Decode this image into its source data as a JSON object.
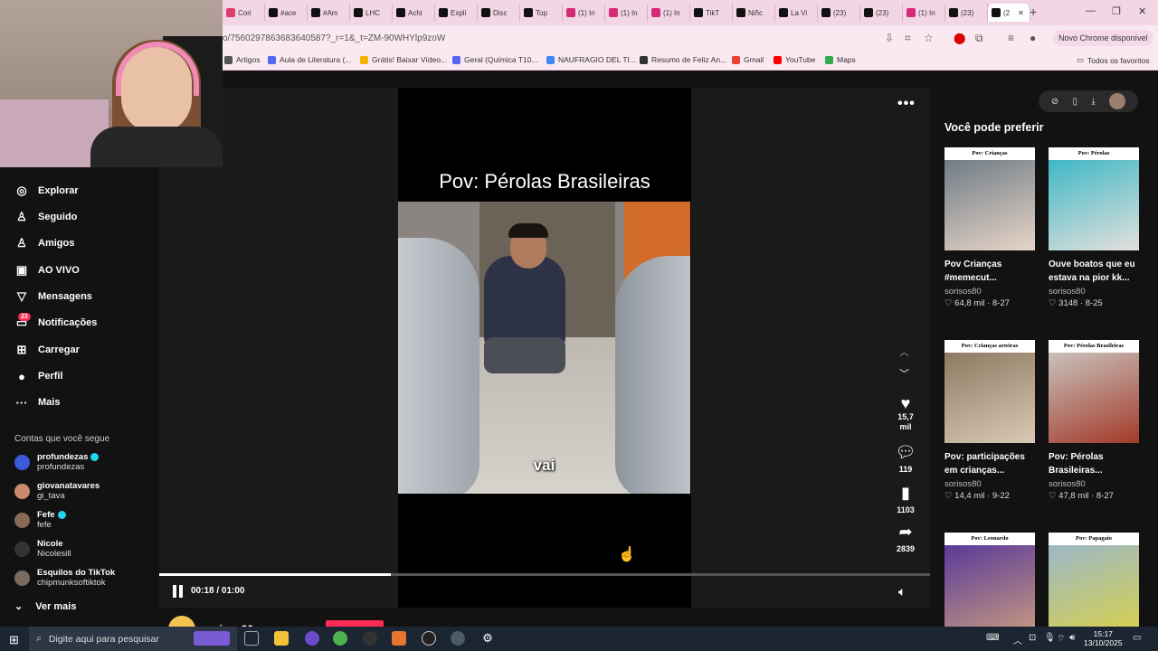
{
  "browser": {
    "tabs": [
      {
        "label": "Cori",
        "color": "#e03d6b"
      },
      {
        "label": "#ace",
        "color": "#111111"
      },
      {
        "label": "#Am",
        "color": "#111111"
      },
      {
        "label": "LHC",
        "color": "#111111"
      },
      {
        "label": "Achi",
        "color": "#111111"
      },
      {
        "label": "Expli",
        "color": "#111111"
      },
      {
        "label": "Disc",
        "color": "#111111"
      },
      {
        "label": "Top",
        "color": "#111111"
      },
      {
        "label": "(1) In",
        "color": "#d62976"
      },
      {
        "label": "(1) In",
        "color": "#d62976"
      },
      {
        "label": "(1) In",
        "color": "#d62976"
      },
      {
        "label": "TikT",
        "color": "#111111"
      },
      {
        "label": "Niñc",
        "color": "#111111"
      },
      {
        "label": "La Vi",
        "color": "#111111"
      },
      {
        "label": "(23)",
        "color": "#111111"
      },
      {
        "label": "(23)",
        "color": "#111111"
      },
      {
        "label": "(1) In",
        "color": "#d62976"
      },
      {
        "label": "(23)",
        "color": "#111111"
      },
      {
        "label": "(2",
        "color": "#111111",
        "active": true
      }
    ],
    "url": "o/7560297863683640587?_r=1&_t=ZM-90WHYlp9zoW",
    "chrome_new_label": "Novo Chrome disponível",
    "bookmarks": [
      {
        "label": "Artigos",
        "color": "#555555"
      },
      {
        "label": "Aula de Literatura (...",
        "color": "#5865f2"
      },
      {
        "label": "Grátis! Baixar Vídeo...",
        "color": "#f0b400"
      },
      {
        "label": "Geral (Química T10...",
        "color": "#5865f2"
      },
      {
        "label": "NAUFRAGIO DEL TI...",
        "color": "#4285f4"
      },
      {
        "label": "Resumo de Feliz An...",
        "color": "#333333"
      },
      {
        "label": "Gmail",
        "color": "#ea4335"
      },
      {
        "label": "YouTube",
        "color": "#ff0000"
      },
      {
        "label": "Maps",
        "color": "#34a853"
      }
    ],
    "all_favorites": "Todos os favoritos"
  },
  "sidebar": {
    "items": [
      {
        "label": "Explorar",
        "icon": "compass-icon",
        "glyph": "◎"
      },
      {
        "label": "Seguido",
        "icon": "following-icon",
        "glyph": "♙"
      },
      {
        "label": "Amigos",
        "icon": "friends-icon",
        "glyph": "♙"
      },
      {
        "label": "AO VIVO",
        "icon": "live-icon",
        "glyph": "▣"
      },
      {
        "label": "Mensagens",
        "icon": "messages-icon",
        "glyph": "▽"
      },
      {
        "label": "Notificações",
        "icon": "notifications-icon",
        "glyph": "▭"
      },
      {
        "label": "Carregar",
        "icon": "upload-icon",
        "glyph": "⊞"
      },
      {
        "label": "Perfil",
        "icon": "profile-icon",
        "glyph": "●"
      },
      {
        "label": "Mais",
        "icon": "more-icon",
        "glyph": "···"
      }
    ],
    "notifications_badge": "23",
    "following_title": "Contas que você segue",
    "accounts": [
      {
        "name": "profundezas",
        "handle": "profundezas",
        "verified": true,
        "color": "#3b5bdb"
      },
      {
        "name": "giovanatavares",
        "handle": "gi_tava",
        "verified": false,
        "color": "#c98b6b"
      },
      {
        "name": "Fefe",
        "handle": "fefe",
        "verified": true,
        "color": "#8a6a55"
      },
      {
        "name": "Nicole",
        "handle": "Nicolesill",
        "verified": false,
        "color": "#333333"
      },
      {
        "name": "Esquilos do TikTok",
        "handle": "chipmunksoftiktok",
        "verified": false,
        "color": "#7a6b60"
      }
    ],
    "see_more": "Ver mais"
  },
  "video": {
    "title": "Pov: Pérolas Brasileiras",
    "caption": "vai",
    "likes": "15,7\nmil",
    "comments": "119",
    "saves": "1103",
    "shares": "2839",
    "time": "00:18 / 01:00",
    "progress": 0.3,
    "author": "sorisos80"
  },
  "recommendations": {
    "title": "Você pode preferir",
    "items": [
      {
        "thumb_title": "Pov: Crianças",
        "desc": "Pov Crianças #memecut...",
        "user": "sorisos80",
        "likes": "64,8 mil",
        "date": "8-27",
        "c1": "#6f7c86",
        "c2": "#e8d5c8"
      },
      {
        "thumb_title": "Pov: Pérolas",
        "desc": "Ouve boatos que eu estava na pior kk...",
        "user": "sorisos80",
        "likes": "3148",
        "date": "8-25",
        "c1": "#3fb8c6",
        "c2": "#e3e0dc"
      },
      {
        "thumb_title": "Pov: Crianças arteiras",
        "desc": "Pov: participações em crianças...",
        "user": "sorisos80",
        "likes": "14,4 mil",
        "date": "9-22",
        "c1": "#8c7a62",
        "c2": "#d9c9b4"
      },
      {
        "thumb_title": "Pov: Pérolas Brasileiras",
        "desc": "Pov: Pérolas Brasileiras...",
        "user": "sorisos80",
        "likes": "47,8 mil",
        "date": "8-27",
        "c1": "#c9c2bc",
        "c2": "#a33a2a"
      },
      {
        "thumb_title": "Pov: Leonardo",
        "desc": "",
        "user": "",
        "likes": "",
        "date": "",
        "c1": "#5a3a9a",
        "c2": "#c89a80"
      },
      {
        "thumb_title": "Pov: Papagaio",
        "desc": "",
        "user": "",
        "likes": "",
        "date": "",
        "c1": "#9bb8c8",
        "c2": "#d8d14a"
      }
    ]
  },
  "taskbar": {
    "search_placeholder": "Digite aqui para pesquisar",
    "time": "15:17",
    "date": "13/10/2025"
  }
}
